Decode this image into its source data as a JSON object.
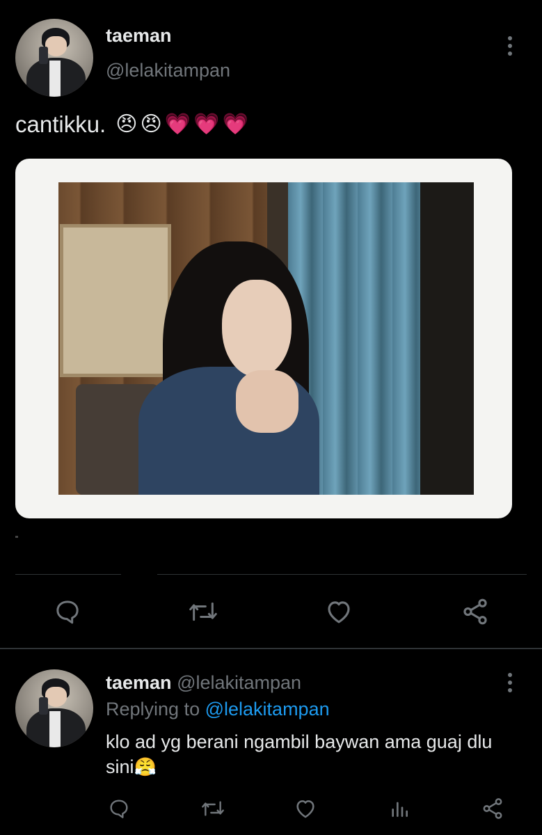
{
  "main_tweet": {
    "author_name": "taeman",
    "author_handle": "@lelakitampan",
    "text": "cantikku.",
    "emojis": [
      "😠",
      "😠",
      "💗",
      "💗",
      "💗"
    ]
  },
  "actions": {
    "reply_icon": "reply-icon",
    "retweet_icon": "retweet-icon",
    "like_icon": "heart-icon",
    "share_icon": "share-icon",
    "analytics_icon": "analytics-icon"
  },
  "reply_tweet": {
    "author_name": "taeman",
    "author_handle": "@lelakitampan",
    "replying_prefix": "Replying to",
    "replying_to": "@lelakitampan",
    "text": "klo ad yg berani ngambil baywan ama guaj dlu sini",
    "emoji": "😤"
  },
  "colors": {
    "background": "#000000",
    "text_primary": "#e7e9ea",
    "text_secondary": "#71767b",
    "link": "#1d9bf0",
    "divider": "#2f3336"
  }
}
